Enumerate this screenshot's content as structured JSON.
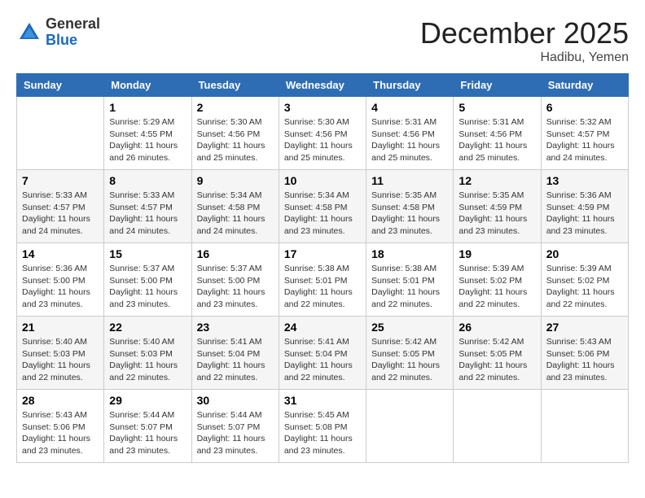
{
  "header": {
    "logo_general": "General",
    "logo_blue": "Blue",
    "month_title": "December 2025",
    "location": "Hadibu, Yemen"
  },
  "days_of_week": [
    "Sunday",
    "Monday",
    "Tuesday",
    "Wednesday",
    "Thursday",
    "Friday",
    "Saturday"
  ],
  "weeks": [
    [
      {
        "day": "",
        "sunrise": "",
        "sunset": "",
        "daylight": ""
      },
      {
        "day": "1",
        "sunrise": "Sunrise: 5:29 AM",
        "sunset": "Sunset: 4:55 PM",
        "daylight": "Daylight: 11 hours and 26 minutes."
      },
      {
        "day": "2",
        "sunrise": "Sunrise: 5:30 AM",
        "sunset": "Sunset: 4:56 PM",
        "daylight": "Daylight: 11 hours and 25 minutes."
      },
      {
        "day": "3",
        "sunrise": "Sunrise: 5:30 AM",
        "sunset": "Sunset: 4:56 PM",
        "daylight": "Daylight: 11 hours and 25 minutes."
      },
      {
        "day": "4",
        "sunrise": "Sunrise: 5:31 AM",
        "sunset": "Sunset: 4:56 PM",
        "daylight": "Daylight: 11 hours and 25 minutes."
      },
      {
        "day": "5",
        "sunrise": "Sunrise: 5:31 AM",
        "sunset": "Sunset: 4:56 PM",
        "daylight": "Daylight: 11 hours and 25 minutes."
      },
      {
        "day": "6",
        "sunrise": "Sunrise: 5:32 AM",
        "sunset": "Sunset: 4:57 PM",
        "daylight": "Daylight: 11 hours and 24 minutes."
      }
    ],
    [
      {
        "day": "7",
        "sunrise": "Sunrise: 5:33 AM",
        "sunset": "Sunset: 4:57 PM",
        "daylight": "Daylight: 11 hours and 24 minutes."
      },
      {
        "day": "8",
        "sunrise": "Sunrise: 5:33 AM",
        "sunset": "Sunset: 4:57 PM",
        "daylight": "Daylight: 11 hours and 24 minutes."
      },
      {
        "day": "9",
        "sunrise": "Sunrise: 5:34 AM",
        "sunset": "Sunset: 4:58 PM",
        "daylight": "Daylight: 11 hours and 24 minutes."
      },
      {
        "day": "10",
        "sunrise": "Sunrise: 5:34 AM",
        "sunset": "Sunset: 4:58 PM",
        "daylight": "Daylight: 11 hours and 23 minutes."
      },
      {
        "day": "11",
        "sunrise": "Sunrise: 5:35 AM",
        "sunset": "Sunset: 4:58 PM",
        "daylight": "Daylight: 11 hours and 23 minutes."
      },
      {
        "day": "12",
        "sunrise": "Sunrise: 5:35 AM",
        "sunset": "Sunset: 4:59 PM",
        "daylight": "Daylight: 11 hours and 23 minutes."
      },
      {
        "day": "13",
        "sunrise": "Sunrise: 5:36 AM",
        "sunset": "Sunset: 4:59 PM",
        "daylight": "Daylight: 11 hours and 23 minutes."
      }
    ],
    [
      {
        "day": "14",
        "sunrise": "Sunrise: 5:36 AM",
        "sunset": "Sunset: 5:00 PM",
        "daylight": "Daylight: 11 hours and 23 minutes."
      },
      {
        "day": "15",
        "sunrise": "Sunrise: 5:37 AM",
        "sunset": "Sunset: 5:00 PM",
        "daylight": "Daylight: 11 hours and 23 minutes."
      },
      {
        "day": "16",
        "sunrise": "Sunrise: 5:37 AM",
        "sunset": "Sunset: 5:00 PM",
        "daylight": "Daylight: 11 hours and 23 minutes."
      },
      {
        "day": "17",
        "sunrise": "Sunrise: 5:38 AM",
        "sunset": "Sunset: 5:01 PM",
        "daylight": "Daylight: 11 hours and 22 minutes."
      },
      {
        "day": "18",
        "sunrise": "Sunrise: 5:38 AM",
        "sunset": "Sunset: 5:01 PM",
        "daylight": "Daylight: 11 hours and 22 minutes."
      },
      {
        "day": "19",
        "sunrise": "Sunrise: 5:39 AM",
        "sunset": "Sunset: 5:02 PM",
        "daylight": "Daylight: 11 hours and 22 minutes."
      },
      {
        "day": "20",
        "sunrise": "Sunrise: 5:39 AM",
        "sunset": "Sunset: 5:02 PM",
        "daylight": "Daylight: 11 hours and 22 minutes."
      }
    ],
    [
      {
        "day": "21",
        "sunrise": "Sunrise: 5:40 AM",
        "sunset": "Sunset: 5:03 PM",
        "daylight": "Daylight: 11 hours and 22 minutes."
      },
      {
        "day": "22",
        "sunrise": "Sunrise: 5:40 AM",
        "sunset": "Sunset: 5:03 PM",
        "daylight": "Daylight: 11 hours and 22 minutes."
      },
      {
        "day": "23",
        "sunrise": "Sunrise: 5:41 AM",
        "sunset": "Sunset: 5:04 PM",
        "daylight": "Daylight: 11 hours and 22 minutes."
      },
      {
        "day": "24",
        "sunrise": "Sunrise: 5:41 AM",
        "sunset": "Sunset: 5:04 PM",
        "daylight": "Daylight: 11 hours and 22 minutes."
      },
      {
        "day": "25",
        "sunrise": "Sunrise: 5:42 AM",
        "sunset": "Sunset: 5:05 PM",
        "daylight": "Daylight: 11 hours and 22 minutes."
      },
      {
        "day": "26",
        "sunrise": "Sunrise: 5:42 AM",
        "sunset": "Sunset: 5:05 PM",
        "daylight": "Daylight: 11 hours and 22 minutes."
      },
      {
        "day": "27",
        "sunrise": "Sunrise: 5:43 AM",
        "sunset": "Sunset: 5:06 PM",
        "daylight": "Daylight: 11 hours and 23 minutes."
      }
    ],
    [
      {
        "day": "28",
        "sunrise": "Sunrise: 5:43 AM",
        "sunset": "Sunset: 5:06 PM",
        "daylight": "Daylight: 11 hours and 23 minutes."
      },
      {
        "day": "29",
        "sunrise": "Sunrise: 5:44 AM",
        "sunset": "Sunset: 5:07 PM",
        "daylight": "Daylight: 11 hours and 23 minutes."
      },
      {
        "day": "30",
        "sunrise": "Sunrise: 5:44 AM",
        "sunset": "Sunset: 5:07 PM",
        "daylight": "Daylight: 11 hours and 23 minutes."
      },
      {
        "day": "31",
        "sunrise": "Sunrise: 5:45 AM",
        "sunset": "Sunset: 5:08 PM",
        "daylight": "Daylight: 11 hours and 23 minutes."
      },
      {
        "day": "",
        "sunrise": "",
        "sunset": "",
        "daylight": ""
      },
      {
        "day": "",
        "sunrise": "",
        "sunset": "",
        "daylight": ""
      },
      {
        "day": "",
        "sunrise": "",
        "sunset": "",
        "daylight": ""
      }
    ]
  ]
}
